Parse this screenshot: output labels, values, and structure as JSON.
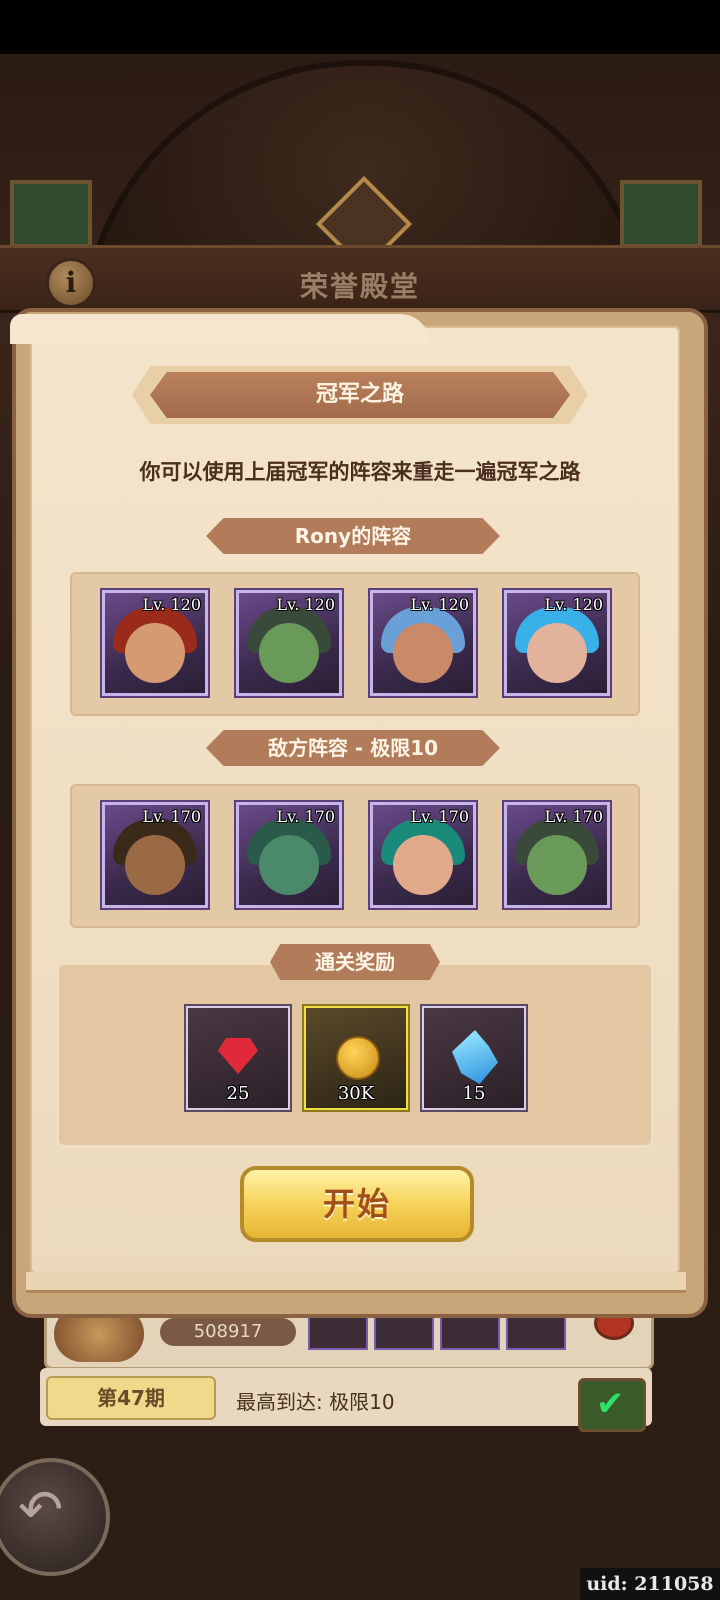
{
  "screen": {
    "hall_title": "荣誉殿堂",
    "info_icon": "i",
    "uid": "uid: 211058"
  },
  "dialog": {
    "title": "冠军之路",
    "description": "你可以使用上届冠军的阵容来重走一遍冠军之路",
    "ally_section": {
      "label": "Rony的阵容",
      "heroes": [
        {
          "level": "Lv. 120",
          "icon": "hero-red-hair-portrait"
        },
        {
          "level": "Lv. 120",
          "icon": "hero-green-orc-portrait"
        },
        {
          "level": "Lv. 120",
          "icon": "hero-blue-hair-portrait"
        },
        {
          "level": "Lv. 120",
          "icon": "hero-cyan-hair-portrait"
        }
      ]
    },
    "enemy_section": {
      "label": "敌方阵容 - 极限10",
      "heroes": [
        {
          "level": "Lv. 170",
          "icon": "hero-braided-warrior-portrait"
        },
        {
          "level": "Lv. 170",
          "icon": "hero-lizard-beast-portrait"
        },
        {
          "level": "Lv. 170",
          "icon": "hero-teal-hair-portrait"
        },
        {
          "level": "Lv. 170",
          "icon": "hero-green-orc-portrait"
        }
      ]
    },
    "rewards_section": {
      "label": "通关奖励",
      "items": [
        {
          "count": "25",
          "icon": "ruby-gem-icon"
        },
        {
          "count": "30K",
          "icon": "gold-coin-icon"
        },
        {
          "count": "15",
          "icon": "blue-crystal-icon"
        }
      ]
    },
    "start_button": "开始"
  },
  "background": {
    "score": "508917",
    "period": "第47期",
    "best_reached": "最高到达: 极限10"
  },
  "colors": {
    "ribbon": "#b27b5a",
    "parchment": "#f1e0c4",
    "button_gold": "#f6d35a"
  }
}
